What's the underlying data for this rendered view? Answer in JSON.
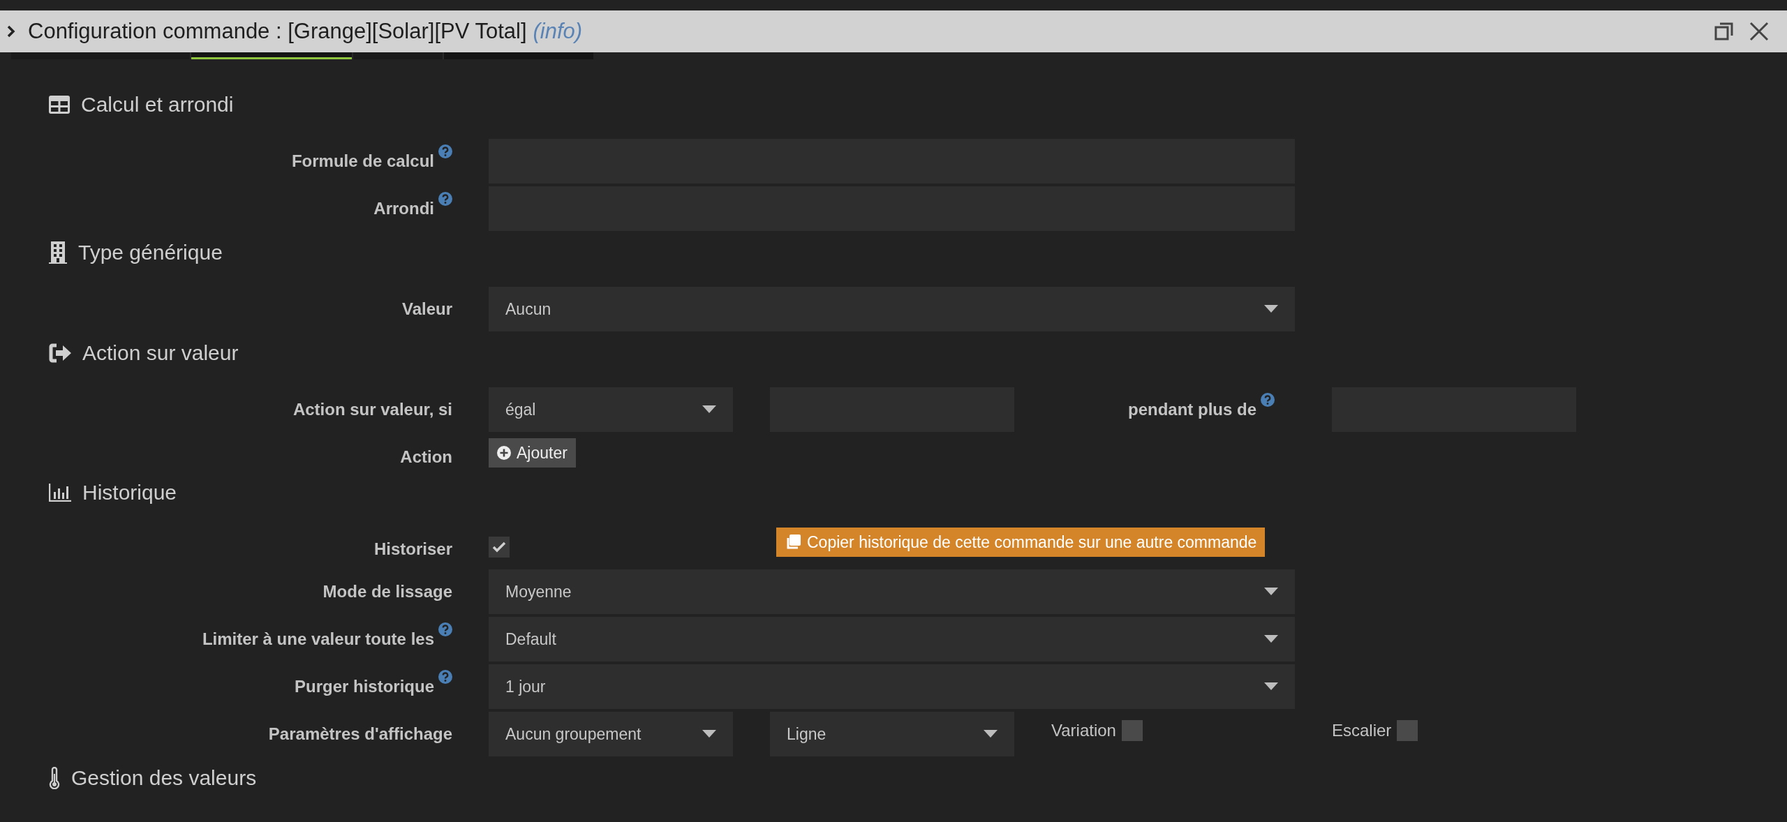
{
  "window": {
    "title": "Configuration commande : [Grange][Solar][PV Total]",
    "subtitle": "(info)"
  },
  "tabs": [
    {
      "selected": false
    },
    {
      "selected": true
    },
    {
      "selected": false
    }
  ],
  "sections": [
    {
      "title": "Calcul et arrondi",
      "rows": [
        {
          "kind": "input",
          "label": "Formule de calcul",
          "help": true
        },
        {
          "kind": "input",
          "label": "Arrondi",
          "help": true
        }
      ]
    },
    {
      "title": "Type générique",
      "rows": [
        {
          "kind": "select",
          "label": "Valeur",
          "help": false,
          "value": "Aucun"
        }
      ]
    },
    {
      "title": "Action sur valeur",
      "rows": [
        {
          "kind": "condition",
          "label": "Action sur valeur, si",
          "help": false,
          "value": "égal",
          "extra_label": "pendant plus de",
          "extra_help": true
        },
        {
          "kind": "button",
          "label": "Action",
          "help": false,
          "button": "Ajouter"
        }
      ]
    },
    {
      "title": "Historique",
      "rows": [
        {
          "kind": "check",
          "label": "Historiser",
          "help": false,
          "checked": true,
          "button": "Copier historique de cette commande sur une autre commande"
        },
        {
          "kind": "select",
          "label": "Mode de lissage",
          "help": false,
          "value": "Moyenne"
        },
        {
          "kind": "select",
          "label": "Limiter à une valeur toute les",
          "help": true,
          "value": "Default"
        },
        {
          "kind": "select",
          "label": "Purger historique",
          "help": true,
          "value": "1 jour"
        },
        {
          "kind": "display",
          "label": "Paramètres d'affichage",
          "help": false,
          "selects": [
            "Aucun groupement",
            "Ligne"
          ],
          "options": [
            {
              "label": "Variation",
              "checked": false
            },
            {
              "label": "Escalier",
              "checked": false
            }
          ]
        }
      ]
    },
    {
      "title": "Gestion des valeurs"
    }
  ]
}
